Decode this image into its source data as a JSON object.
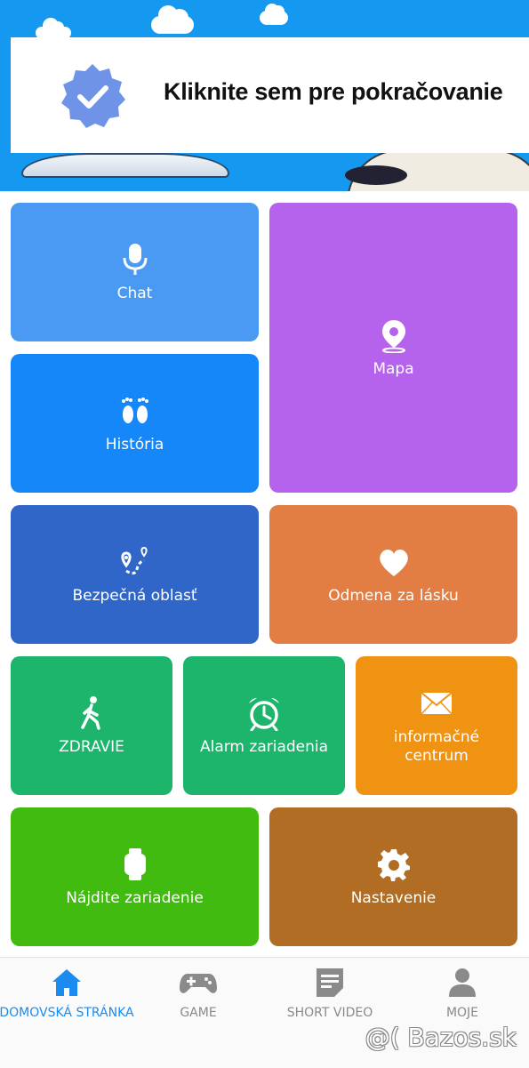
{
  "banner": {
    "notice_text": "Kliknite sem pre pokračovanie",
    "badge_icon": "verified-check-badge-icon"
  },
  "tiles": {
    "chat": {
      "label": "Chat",
      "icon": "microphone-icon",
      "color": "#4a9af4"
    },
    "map": {
      "label": "Mapa",
      "icon": "location-pin-icon",
      "color": "#b563ec"
    },
    "history": {
      "label": "História",
      "icon": "footprints-icon",
      "color": "#1587f8"
    },
    "safe": {
      "label": "Bezpečná oblasť",
      "icon": "route-icon",
      "color": "#2f66c8"
    },
    "love": {
      "label": "Odmena za lásku",
      "icon": "heart-icon",
      "color": "#e27e43"
    },
    "health": {
      "label": "ZDRAVIE",
      "icon": "walking-person-icon",
      "color": "#1cb56b"
    },
    "alarm": {
      "label": "Alarm zariadenia",
      "icon": "alarm-clock-icon",
      "color": "#1cb56b"
    },
    "info": {
      "label": "informačné centrum",
      "icon": "envelope-icon",
      "color": "#f09312"
    },
    "find": {
      "label": "Nájdite zariadenie",
      "icon": "smartwatch-icon",
      "color": "#42bb10"
    },
    "settings": {
      "label": "Nastavenie",
      "icon": "gear-icon",
      "color": "#b26d24"
    }
  },
  "bottom_nav": {
    "items": [
      {
        "label": "DOMOVSKÁ STRÁNKA",
        "icon": "home-icon",
        "active": true
      },
      {
        "label": "GAME",
        "icon": "gamepad-icon",
        "active": false
      },
      {
        "label": "SHORT VIDEO",
        "icon": "note-icon",
        "active": false
      },
      {
        "label": "MOJE",
        "icon": "user-icon",
        "active": false
      }
    ],
    "active_color": "#1a8cf0",
    "inactive_color": "#8a8a8a"
  },
  "watermark": "@( Bazos.sk"
}
